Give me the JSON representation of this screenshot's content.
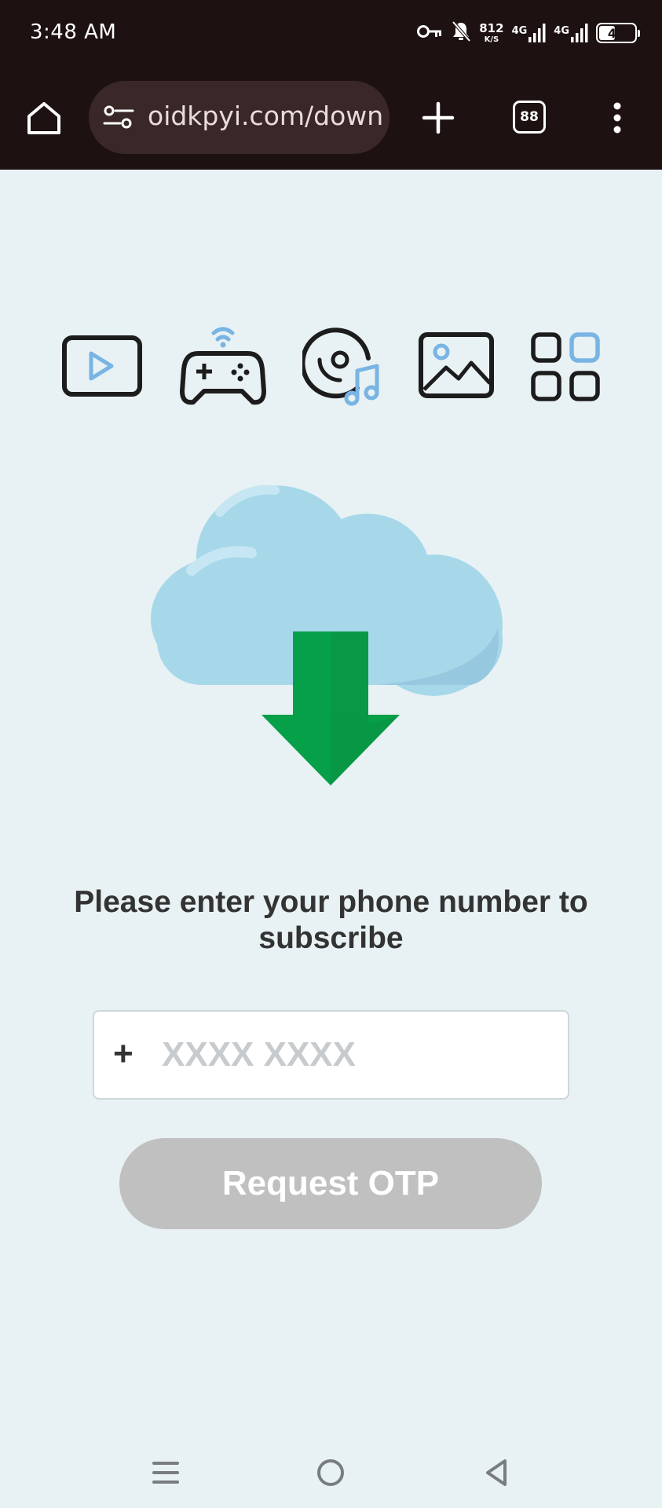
{
  "status_bar": {
    "time": "3:48 AM",
    "net_speed_value": "812",
    "net_speed_unit": "K/S",
    "sim1_label": "4G",
    "sim2_label": "4G",
    "battery_percent": "45",
    "battery_level": 0.45,
    "icons": [
      "vpn-key-icon",
      "notifications-off-icon",
      "signal-icon",
      "signal-icon",
      "battery-icon"
    ]
  },
  "browser": {
    "url": "oidkpyi.com/download",
    "tab_count": "88",
    "icons": [
      "home-icon",
      "site-settings-icon",
      "plus-icon",
      "tabs-icon",
      "more-vert-icon"
    ]
  },
  "categories": [
    {
      "name": "video",
      "icon": "video-play-icon"
    },
    {
      "name": "games",
      "icon": "gamepad-icon"
    },
    {
      "name": "music",
      "icon": "music-disc-icon"
    },
    {
      "name": "images",
      "icon": "image-icon"
    },
    {
      "name": "apps",
      "icon": "apps-grid-icon"
    }
  ],
  "illustration": {
    "icon": "cloud-download-icon"
  },
  "form": {
    "prompt": "Please enter your phone number to subscribe",
    "country_prefix": "+",
    "phone_placeholder": "XXXX XXXX",
    "phone_value": "",
    "submit_label": "Request OTP"
  },
  "colors": {
    "page_background": "#e8f1f3",
    "chrome_background": "#1e1111",
    "accent_blue": "#78b4e4",
    "cloud_blue": "#a6d8ea",
    "arrow_green": "#00a040",
    "button_disabled": "#c0c0c0",
    "text_dark": "#333333"
  },
  "system_nav": {
    "icons": [
      "recents-menu-icon",
      "home-circle-icon",
      "back-triangle-icon"
    ]
  }
}
